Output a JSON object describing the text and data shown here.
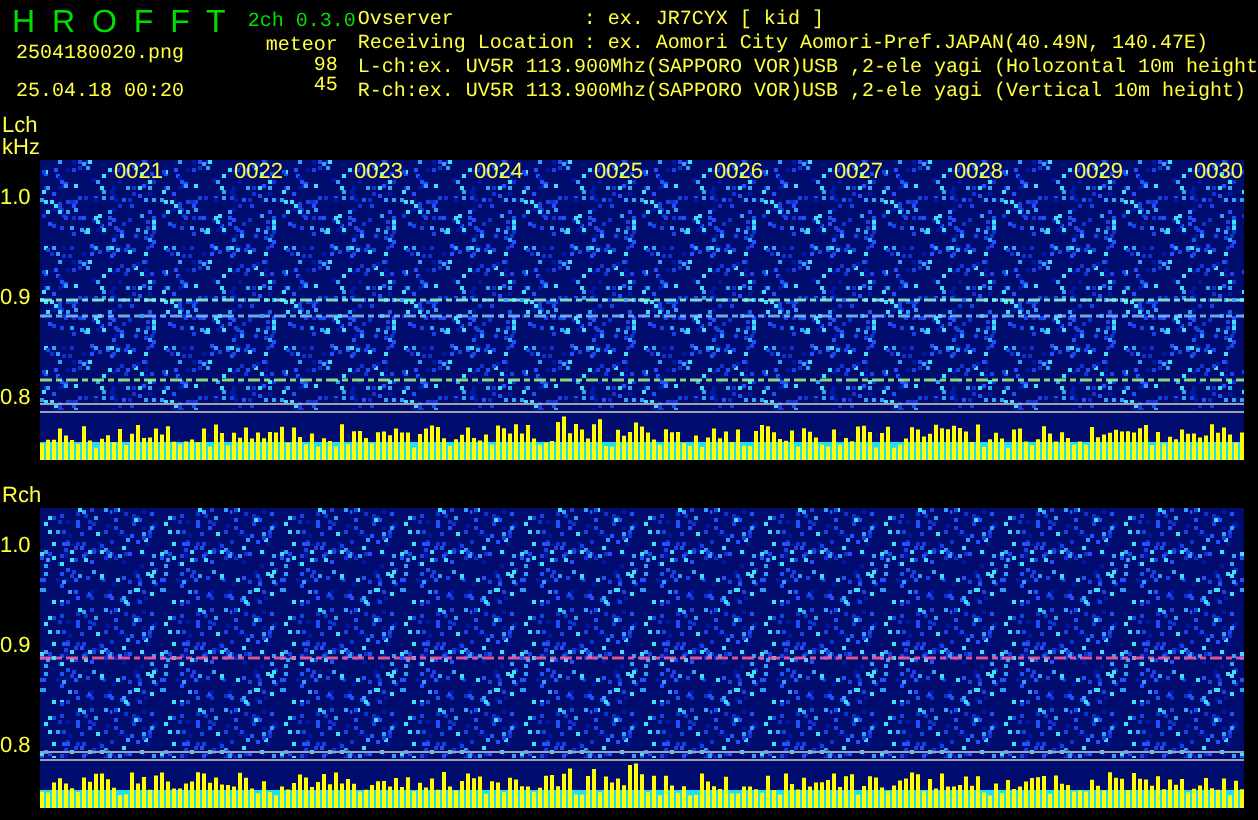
{
  "header": {
    "title": "H R O F F T",
    "version": "2ch 0.3.0",
    "filename": "2504180020.png",
    "datetime": "25.04.18 00:20",
    "meteor_label": "meteor",
    "counts": [
      "98",
      "45"
    ]
  },
  "info": [
    {
      "label": "Ovserver",
      "value": ": ex. JR7CYX [ kid ]"
    },
    {
      "label": "Receiving Location",
      "value": ": ex. Aomori City Aomori-Pref.JAPAN(40.49N, 140.47E)"
    }
  ],
  "channel_lines": [
    "L-ch:ex. UV5R 113.900Mhz(SAPPORO VOR)USB ,2-ele yagi (Holozontal 10m height",
    "R-ch:ex. UV5R 113.900Mhz(SAPPORO VOR)USB ,2-ele yagi (Vertical 10m height)"
  ],
  "channels": [
    {
      "label": "Lch",
      "unit": "kHz",
      "time_labels": [
        "0021",
        "0022",
        "0023",
        "0024",
        "0025",
        "0026",
        "0027",
        "0028",
        "0029",
        "0030"
      ],
      "y_labels": [
        "1.0",
        "0.9",
        "0.8"
      ]
    },
    {
      "label": "Rch",
      "y_labels": [
        "1.0",
        "0.9",
        "0.8"
      ]
    }
  ]
}
